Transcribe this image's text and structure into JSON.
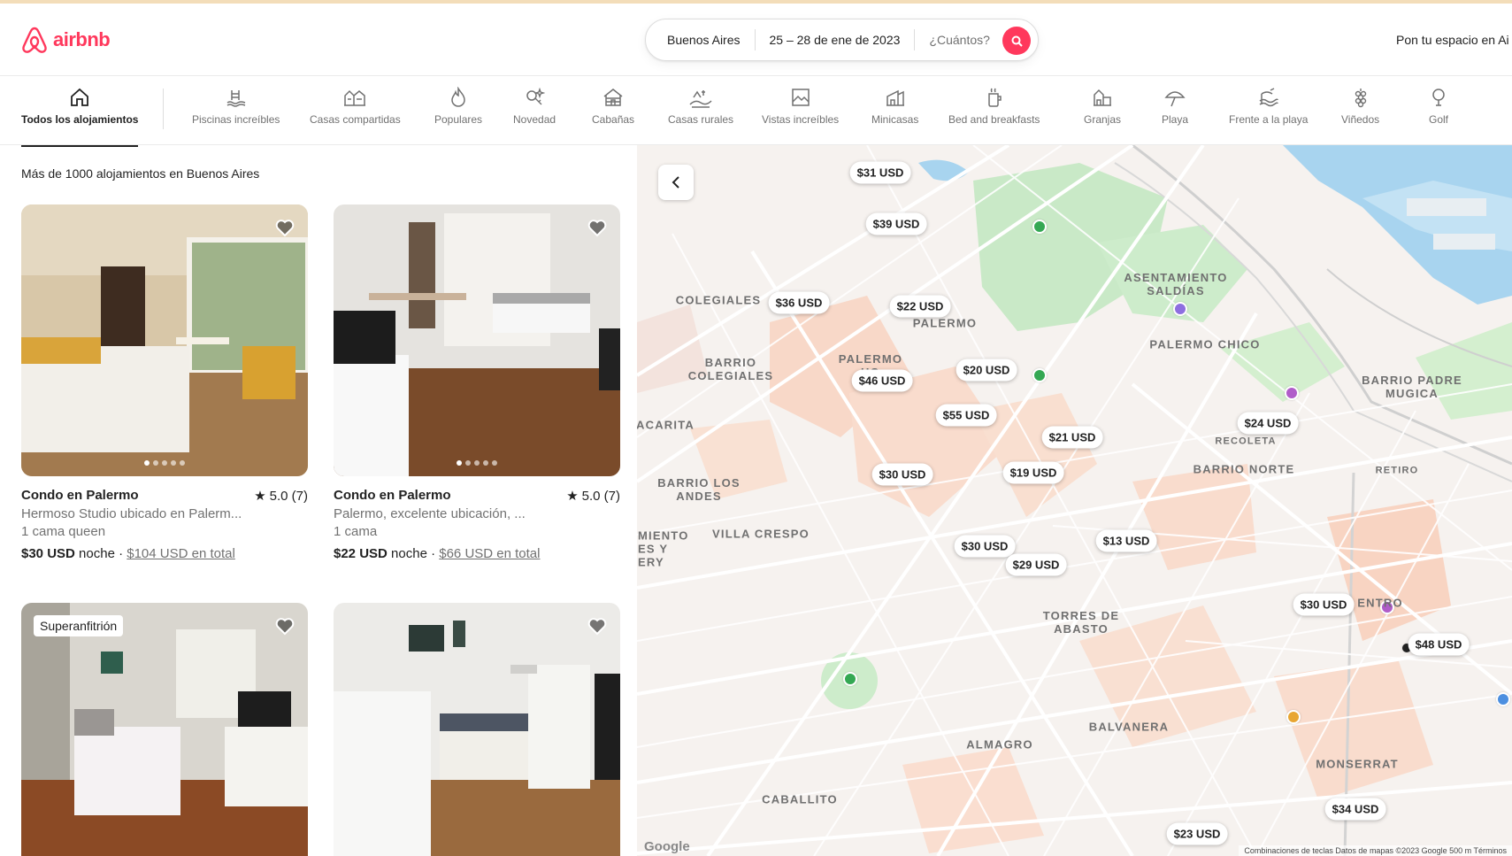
{
  "header": {
    "brand": "airbnb",
    "search": {
      "location": "Buenos Aires",
      "dates": "25 – 28 de ene de 2023",
      "guests": "¿Cuántos?"
    },
    "host_link": "Pon tu espacio en Ai"
  },
  "categories": [
    {
      "label": "Todos los alojamientos",
      "icon": "home-icon",
      "active": true
    },
    {
      "label": "Piscinas increíbles",
      "icon": "pool-icon"
    },
    {
      "label": "Casas compartidas",
      "icon": "shared-house-icon"
    },
    {
      "label": "Populares",
      "icon": "flame-icon"
    },
    {
      "label": "Novedad",
      "icon": "sparkle-key-icon"
    },
    {
      "label": "Cabañas",
      "icon": "cabin-icon"
    },
    {
      "label": "Casas rurales",
      "icon": "countryside-icon"
    },
    {
      "label": "Vistas increíbles",
      "icon": "view-icon"
    },
    {
      "label": "Minicasas",
      "icon": "tiny-house-icon"
    },
    {
      "label": "Bed and breakfasts",
      "icon": "breakfast-icon"
    },
    {
      "label": "Granjas",
      "icon": "farm-icon"
    },
    {
      "label": "Playa",
      "icon": "umbrella-icon"
    },
    {
      "label": "Frente a la playa",
      "icon": "beachfront-icon"
    },
    {
      "label": "Viñedos",
      "icon": "vineyard-icon"
    },
    {
      "label": "Golf",
      "icon": "golf-icon"
    }
  ],
  "listings": {
    "count_text": "Más de 1000 alojamientos en Buenos Aires",
    "items": [
      {
        "title": "Condo en Palermo",
        "rating": "5.0 (7)",
        "subtitle": "Hermoso Studio ubicado en Palerm...",
        "beds": "1 cama queen",
        "price": "$30 USD",
        "per": " noche · ",
        "total": "$104 USD en total"
      },
      {
        "title": "Condo en Palermo",
        "rating": "5.0 (7)",
        "subtitle": "Palermo, excelente ubicación, ...",
        "beds": "1 cama",
        "price": "$22 USD",
        "per": " noche · ",
        "total": "$66 USD en total"
      },
      {
        "badge": "Superanfitrión"
      },
      {}
    ]
  },
  "map": {
    "pins": [
      "$31 USD",
      "$39 USD",
      "$36 USD",
      "$22 USD",
      "$20 USD",
      "$46 USD",
      "$55 USD",
      "$21 USD",
      "$30 USD",
      "$19 USD",
      "$24 USD",
      "$13 USD",
      "$30 USD",
      "$29 USD",
      "$30 USD",
      "$48 USD",
      "$34 USD",
      "$23 USD"
    ],
    "neighborhoods": [
      "COLEGIALES",
      "PALERMO",
      "BARRIO COLEGIALES",
      "PALERMO HO",
      "ACARITA",
      "BARRIO LOS ANDES",
      "VILLA CRESPO",
      "MIENTO ES Y ERY",
      "ASENTAMIENTO SALDÍAS",
      "PALERMO CHICO",
      "BARRIO PADRE MUGICA",
      "RECOLETA",
      "BARRIO NORTE",
      "RETIRO",
      "TORRES DE ABASTO",
      "ALMAGRO",
      "BALVANERA",
      "CABALLITO",
      "MONSERRAT",
      "ENTRO"
    ],
    "google": "Google",
    "footer": "Combinaciones de teclas   Datos de mapas ©2023 Google   500 m   Términos"
  }
}
